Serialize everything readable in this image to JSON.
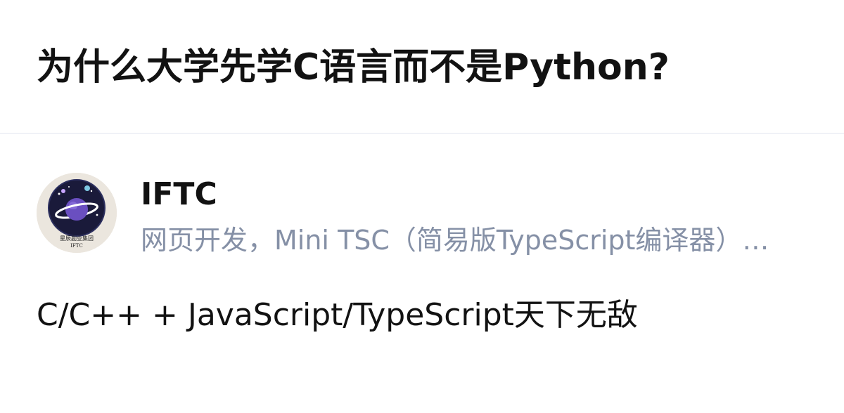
{
  "question": {
    "title": "为什么大学先学C语言而不是Python?"
  },
  "author": {
    "name": "IFTC",
    "bio": "网页开发，Mini TSC（简易版TypeScript编译器）…",
    "avatar": {
      "icon": "planet-logo-icon",
      "caption_cn": "星辰副业集团",
      "caption_en": "IFTC"
    }
  },
  "answer": {
    "excerpt": "C/C++ + JavaScript/TypeScript天下无敌"
  },
  "colors": {
    "title_text": "#121212",
    "bio_text": "#8590a6",
    "divider": "#f0f2f7",
    "avatar_bg": "#ebe6de",
    "avatar_disc": "#1a1a3a",
    "planet": "#6a4fc0"
  }
}
